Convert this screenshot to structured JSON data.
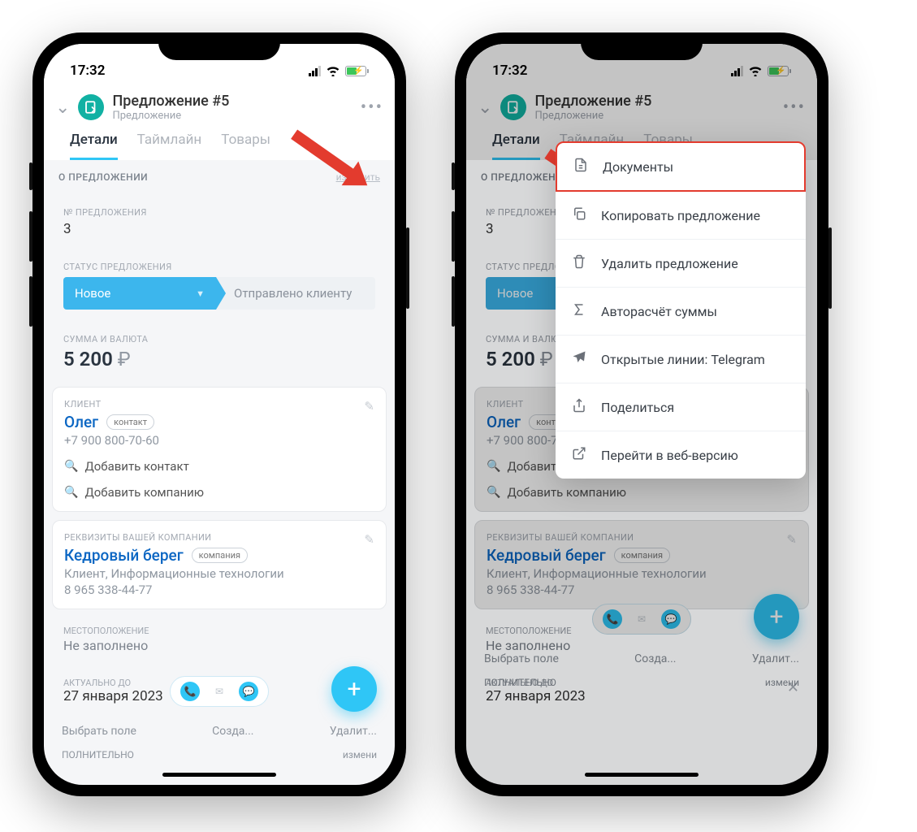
{
  "status_bar": {
    "time": "17:32"
  },
  "header": {
    "title": "Предложение #5",
    "subtitle": "Предложение"
  },
  "tabs": [
    "Детали",
    "Таймлайн",
    "Товары"
  ],
  "about": {
    "section": "О ПРЕДЛОЖЕНИИ",
    "edit": "изменить",
    "num_lbl": "№ ПРЕДЛОЖЕНИЯ",
    "num_val": "3",
    "status_lbl": "СТАТУС ПРЕДЛОЖЕНИЯ",
    "status_new": "Новое",
    "status_sent": "Отправлено клиенту",
    "amount_lbl": "СУММА И ВАЛЮТА",
    "amount_val": "5 200",
    "amount_cur": "₽"
  },
  "client": {
    "lbl": "КЛИЕНТ",
    "name": "Олег",
    "badge": "контакт",
    "phone": "+7 900 800-70-60",
    "add_contact": "Добавить контакт",
    "add_company": "Добавить компанию"
  },
  "company": {
    "lbl": "РЕКВИЗИТЫ ВАШЕЙ КОМПАНИИ",
    "name": "Кедровый берег",
    "badge": "компания",
    "desc": "Клиент, Информационные технологии",
    "phone": "8 965 338-44-77"
  },
  "location": {
    "lbl": "МЕСТОПОЛОЖЕНИЕ",
    "val": "Не заполнено"
  },
  "valid": {
    "lbl": "АКТУАЛЬНО ДО",
    "val": "27 января 2023"
  },
  "bottom": {
    "select": "Выбрать поле",
    "create": "Созда...",
    "delete": "Удалит..."
  },
  "extra": {
    "title": "ПОЛНИТЕЛЬНО",
    "edit": "измени"
  },
  "menu": {
    "documents": "Документы",
    "copy": "Копировать предложение",
    "delete": "Удалить предложение",
    "autocalc": "Авторасчёт суммы",
    "telegram": "Открытые линии: Telegram",
    "share": "Поделиться",
    "web": "Перейти в веб-версию"
  }
}
